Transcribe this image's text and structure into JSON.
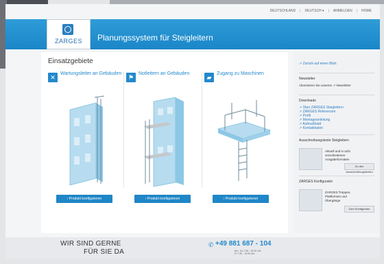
{
  "brand": {
    "logo_text": "ZARGES"
  },
  "header": {
    "title": "Planungssystem für Steigleitern"
  },
  "toplinks": [
    "DEUTSCHLAND",
    "|",
    "DEUTSCH ▾",
    "|",
    "ANMELDEN",
    "|",
    "HOME"
  ],
  "main": {
    "section_title": "Einsatzgebiete",
    "columns": [
      {
        "label": "Wartungsleiter an Gebäuden",
        "button": "› Produkt konfigurieren"
      },
      {
        "label": "Notleitern an Gebäuden",
        "button": "› Produkt konfigurieren"
      },
      {
        "label": "Zugang zu Maschinen",
        "button": "› Produkt konfigurieren"
      }
    ]
  },
  "sidebar": {
    "top_link": "↗ Zurück auf einen Blick",
    "newsletter_head": "Newsletter",
    "newsletter_text": "Abonnieren Sie unseren ↗ Newsletter",
    "downloads_head": "Downloads",
    "downloads": [
      "↗ Über ZARGES Steigleitern",
      "↗ ZARGES Referenzen",
      "↗ Profil",
      "↗ Montageanleitung",
      "↗ Aufmaßblatt",
      "↗ Kontaktdaten"
    ],
    "tool_head": "Ausschreibungstexte Steigleitern",
    "tool_text": [
      "Aktuell und in acht",
      "verschiedenen",
      "Ausgabeformaten"
    ],
    "tool_btn": "Zu den Ausschreibungstexten",
    "config_head": "ZARGES Konfigurator",
    "config_text": [
      "ZARGES Treppen,",
      "Plattformen und",
      "Übergänge"
    ],
    "config_btn": "Zum Konfigurator"
  },
  "footer": {
    "line1": "WIR SIND GERNE",
    "line2": "FÜR SIE DA",
    "phone": "+49 881 687 - 104",
    "hours": [
      "Mo - Do 7:30 - 16:30 Uhr",
      "Fr 7:30 - 13:00 Uhr"
    ]
  }
}
